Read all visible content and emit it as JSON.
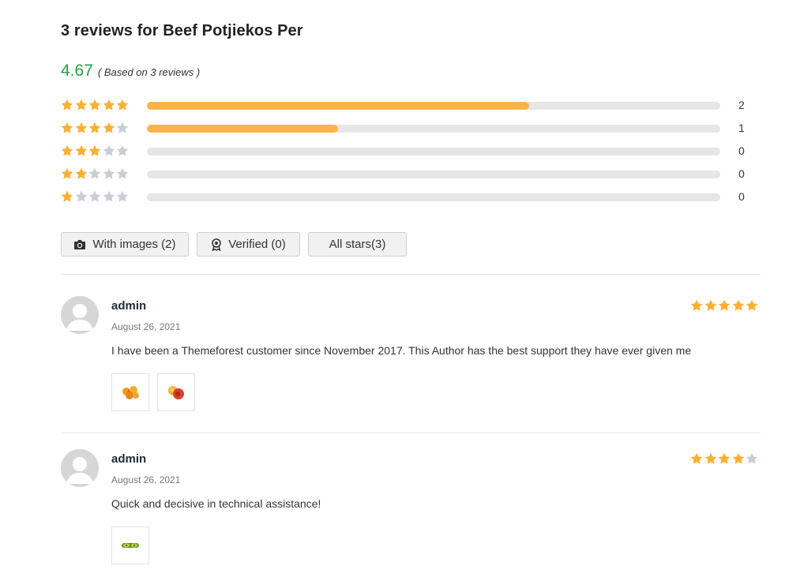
{
  "title": "3 reviews for Beef Potjiekos Per",
  "summary": {
    "average": "4.67",
    "based_on": "( Based on 3 reviews )"
  },
  "distribution": [
    {
      "stars": 5,
      "count": "2",
      "fraction": 0.6667
    },
    {
      "stars": 4,
      "count": "1",
      "fraction": 0.3333
    },
    {
      "stars": 3,
      "count": "0",
      "fraction": 0
    },
    {
      "stars": 2,
      "count": "0",
      "fraction": 0
    },
    {
      "stars": 1,
      "count": "0",
      "fraction": 0
    }
  ],
  "filters": {
    "with_images": "With images (2)",
    "verified": "Verified (0)",
    "all_stars": "All stars(3)"
  },
  "reviews": [
    {
      "author": "admin",
      "date": "August 26, 2021",
      "text": "I have been a Themeforest customer since November 2017. This Author has the best support they have ever given me",
      "rating": 5,
      "images": [
        "orange-fruit-image",
        "peach-fruit-image"
      ]
    },
    {
      "author": "admin",
      "date": "August 26, 2021",
      "text": "Quick and decisive in technical assistance!",
      "rating": 4,
      "images": [
        "kiwi-fruit-image"
      ]
    }
  ],
  "colors": {
    "star_on": "#fbb034",
    "star_off": "#c9ced6",
    "bar_fill": "#fdb447",
    "bar_track": "#e6e6e6",
    "average": "#24a148"
  }
}
